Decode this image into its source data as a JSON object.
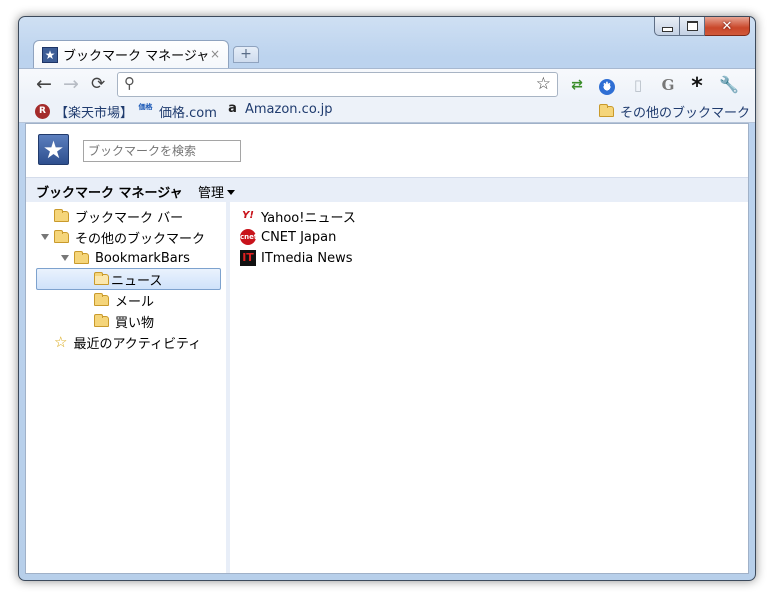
{
  "window": {
    "tab_title": "ブックマーク マネージャ",
    "tab_close": "×",
    "new_tab": "+"
  },
  "toolbar": {
    "back": "←",
    "forward": "→",
    "reload": "⟳",
    "search_glyph": "⚲",
    "star_glyph": "☆",
    "omnibox_value": ""
  },
  "bookmarks_bar": {
    "items": [
      {
        "label": "【楽天市場】",
        "icon": "rakuten-icon",
        "glyph": "R"
      },
      {
        "label": "価格.com",
        "icon": "kakaku-icon",
        "glyph": "価格"
      },
      {
        "label": "Amazon.co.jp",
        "icon": "amazon-icon",
        "glyph": "a"
      }
    ],
    "other": "その他のブックマーク"
  },
  "manager": {
    "search_placeholder": "ブックマークを検索",
    "title": "ブックマーク マネージャ",
    "organize": "管理",
    "tree": [
      {
        "label": "ブックマーク バー",
        "expanded": false
      },
      {
        "label": "その他のブックマーク",
        "expanded": true
      },
      {
        "label": "BookmarkBars",
        "expanded": true
      },
      {
        "label": "ニュース",
        "selected": true
      },
      {
        "label": "メール"
      },
      {
        "label": "買い物"
      },
      {
        "label": "最近のアクティビティ",
        "icon": "star-icon"
      }
    ],
    "list": [
      {
        "label": "Yahoo!ニュース",
        "icon": "yahoo-icon",
        "glyph": "Y!"
      },
      {
        "label": "CNET Japan",
        "icon": "cnet-icon",
        "glyph": "cnet"
      },
      {
        "label": "ITmedia News",
        "icon": "itmedia-icon",
        "glyph": "IT"
      }
    ]
  },
  "colors": {
    "selection_border": "#7da2ce",
    "header_bg": "#e8eef8",
    "close_button": "#c9472a"
  }
}
